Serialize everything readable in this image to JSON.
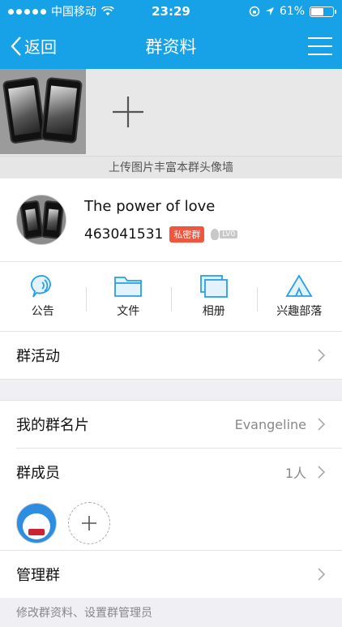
{
  "status_bar": {
    "carrier": "中国移动",
    "time": "23:29",
    "battery": "61%",
    "battery_level": 0.61
  },
  "navbar": {
    "back_label": "返回",
    "title": "群资料"
  },
  "photo_wall": {
    "caption": "上传图片丰富本群头像墙"
  },
  "group": {
    "name": "The power of love",
    "id": "463041531",
    "badge": "私密群",
    "level": "LV0"
  },
  "features": [
    {
      "label": "公告",
      "icon": "announcement-icon"
    },
    {
      "label": "文件",
      "icon": "folder-icon"
    },
    {
      "label": "相册",
      "icon": "album-icon"
    },
    {
      "label": "兴趣部落",
      "icon": "tribe-icon"
    }
  ],
  "rows": {
    "activity": "群活动",
    "card_label": "我的群名片",
    "card_value": "Evangeline",
    "members_label": "群成员",
    "members_count": "1人",
    "manage": "管理群",
    "note": "修改群资料、设置群管理员"
  },
  "colors": {
    "accent": "#17a1e6",
    "badge": "#f0553d"
  }
}
